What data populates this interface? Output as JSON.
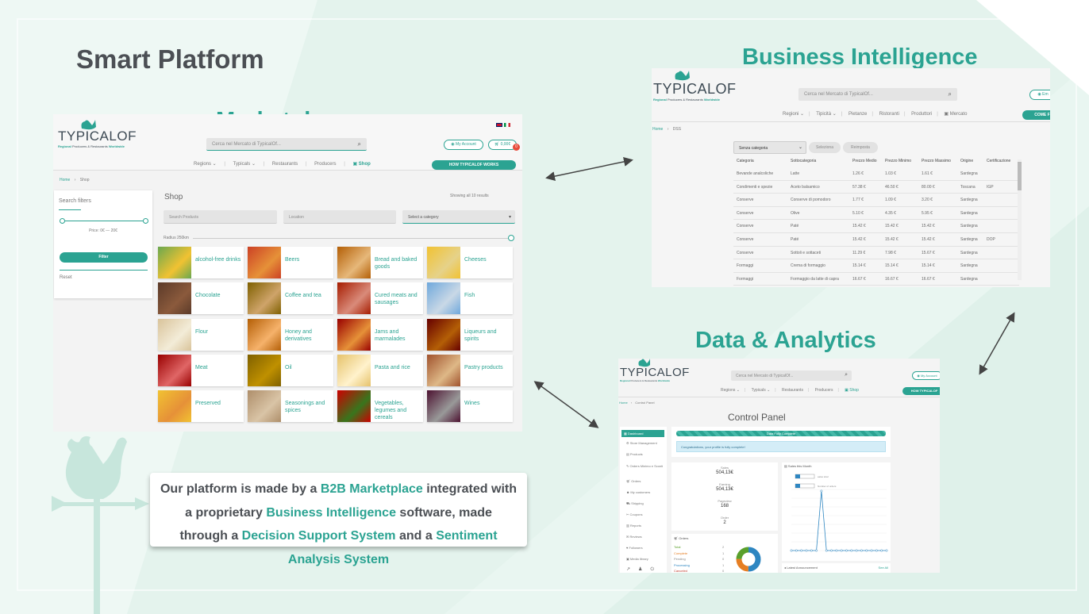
{
  "slide_title": "Smart Platform",
  "headings": {
    "marketplace": "Marketplace",
    "business_intelligence": "Business Intelligence",
    "data_analytics": "Data & Analytics"
  },
  "colors": {
    "accent": "#2ba392",
    "title": "#4b4f54",
    "background": "#e9f6f1"
  },
  "brand": {
    "logo": "TYPICALOF",
    "logo_sub_1": "Regional",
    "logo_sub_2": "Producers & Restaurants",
    "logo_sub_3": "Worldwide"
  },
  "marketplace": {
    "search_placeholder": "Cerca nel Mercato di TypicalOf...",
    "my_account": "My Account",
    "cart_total": "0,00€",
    "cart_count": "0",
    "nav": [
      "Regions ⌄",
      "Typicals ⌄",
      "Restaurants",
      "Producers",
      "Shop"
    ],
    "how_button": "HOW TYPICALOF WORKS",
    "breadcrumb": [
      "Home",
      "›",
      "Shop"
    ],
    "filters_title": "Search filters",
    "price_text": "Price: 0€ — 20€",
    "filter_button": "Filter",
    "reset": "Reset",
    "shop_title": "Shop",
    "results_text": "Showing all 10 results",
    "search_products": "Search Products",
    "location": "Location",
    "select_category": "Select a category",
    "radius": "Radius 250km",
    "categories": [
      "alcohol-free drinks",
      "Beers",
      "Bread and baked goods",
      "Cheeses",
      "Chocolate",
      "Coffee and tea",
      "Cured meats and sausages",
      "Fish",
      "Flour",
      "Honey and derivatives",
      "Jams and marmalades",
      "Liqueurs and spirits",
      "Meat",
      "Oil",
      "Pasta and rice",
      "Pastry products",
      "Preserved",
      "Seasonings and spices",
      "Vegetables, legumes and cereals",
      "Wines"
    ]
  },
  "bi": {
    "search_placeholder": "Cerca nel Mercato di TypicalOf...",
    "account": "Em",
    "nav": [
      "Regioni ⌄",
      "Tipicità ⌄",
      "Pietanze",
      "Ristoranti",
      "Produttori",
      "Mercato"
    ],
    "come_button": "COME F",
    "breadcrumb": [
      "Home",
      "›",
      "DSS"
    ],
    "select_value": "Senza categoria",
    "btn_select": "Seleziona",
    "btn_reset": "Reimposta",
    "columns": [
      "Categoria",
      "Sottocategoria",
      "Prezzo Medio",
      "Prezzo Minimo",
      "Prezzo Massimo",
      "Origine",
      "Certificazione"
    ],
    "rows": [
      [
        "Bevande analcoliche",
        "Latte",
        "1.26 €",
        "1.03 €",
        "1.61 €",
        "Sardegna",
        ""
      ],
      [
        "Condimenti e spezie",
        "Aceto balsamico",
        "57.38 €",
        "46.50 €",
        "80.00 €",
        "Toscana",
        "IGP"
      ],
      [
        "Conserve",
        "Conserve di pomodoro",
        "1.77 €",
        "1.09 €",
        "3.20 €",
        "Sardegna",
        ""
      ],
      [
        "Conserve",
        "Olive",
        "5.10 €",
        "4.35 €",
        "5.95 €",
        "Sardegna",
        ""
      ],
      [
        "Conserve",
        "Paté",
        "15.42 €",
        "15.42 €",
        "15.42 €",
        "Sardegna",
        ""
      ],
      [
        "Conserve",
        "Paté",
        "15.42 €",
        "15.42 €",
        "15.42 €",
        "Sardegna",
        "DOP"
      ],
      [
        "Conserve",
        "Sottoli e sottaceti",
        "11.29 €",
        "7.98 €",
        "15.67 €",
        "Sardegna",
        ""
      ],
      [
        "Formaggi",
        "Crema di formaggio",
        "15.14 €",
        "15.14 €",
        "15.14 €",
        "Sardegna",
        ""
      ],
      [
        "Formaggi",
        "Formaggio da latte di capra",
        "16.67 €",
        "16.67 €",
        "16.67 €",
        "Sardegna",
        ""
      ]
    ]
  },
  "da": {
    "search_placeholder": "Cerca nel Mercato di TypicalOf...",
    "my_account": "My Account",
    "nav": [
      "Regions ⌄",
      "Typicals ⌄",
      "Restaurants",
      "Producers",
      "Shop"
    ],
    "how_button": "HOW TYPICALOF",
    "breadcrumb": [
      "Home",
      "›",
      "Control Panel"
    ],
    "title": "Control Panel",
    "progress_label": "Data Fully Complete",
    "progress": 1.0,
    "congrats": "Congratulations, your profile is fully complete!",
    "sidebar": [
      "Dashboard",
      "Store Management",
      "Products",
      "Orders Minimo e Sconti",
      "Orders",
      "My customers",
      "Shipping",
      "Coupons",
      "Reports",
      "Reviews",
      "Followers",
      "Media library"
    ],
    "stats": [
      {
        "label": "Sales",
        "value": "504,13€"
      },
      {
        "label": "Earning",
        "value": "504,13€"
      },
      {
        "label": "Pageview",
        "value": "168"
      },
      {
        "label": "Order",
        "value": "2"
      }
    ],
    "chart_title": "Sales this Month",
    "legend": [
      "sales total",
      "Number of orders"
    ],
    "orders_title": "Orders",
    "order_statuses": [
      "Total",
      "Complete",
      "Pending",
      "Processing",
      "Canceled"
    ],
    "order_counts": [
      "2",
      "1",
      "0",
      "1",
      "0"
    ],
    "announcement": "Latest Announcement",
    "see_all": "See All"
  },
  "description": {
    "p1": "Our platform is made by a ",
    "k1": "B2B Marketplace",
    "p2": " integrated with a proprietary ",
    "k2": "Business Intelligence",
    "p3": " software, made through a ",
    "k3": "Decision Support System",
    "p4": " and a ",
    "k4": "Sentiment Analysis System"
  }
}
